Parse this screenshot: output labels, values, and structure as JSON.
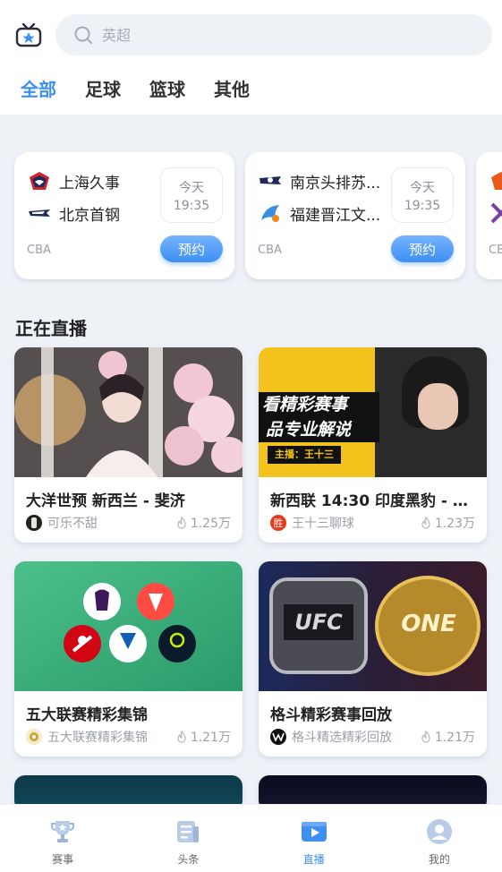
{
  "header": {
    "search_placeholder": "英超",
    "tabs": [
      {
        "label": "全部",
        "active": true
      },
      {
        "label": "足球",
        "active": false
      },
      {
        "label": "篮球",
        "active": false
      },
      {
        "label": "其他",
        "active": false
      }
    ]
  },
  "matches": [
    {
      "home": "上海久事",
      "away": "北京首钢",
      "day": "今天",
      "time": "19:35",
      "league": "CBA",
      "button": "预约"
    },
    {
      "home": "南京头排苏...",
      "away": "福建晋江文...",
      "day": "今天",
      "time": "19:35",
      "league": "CBA",
      "button": "预约"
    },
    {
      "league": "CB"
    }
  ],
  "live": {
    "section_title": "正在直播",
    "items": [
      {
        "title": "大洋世预 新西兰 - 斐济",
        "streamer": "可乐不甜",
        "viewers": "1.25万"
      },
      {
        "title": "新西联 14:30 印度黑豹 - 富...",
        "streamer": "王十三聊球",
        "viewers": "1.23万",
        "avatar_text": "胜",
        "thumb_text_1": "看精彩赛事",
        "thumb_text_2": "品专业解说",
        "thumb_tag": "主播：王十三"
      },
      {
        "title": "五大联赛精彩集锦",
        "streamer": "五大联赛精彩集锦",
        "viewers": "1.21万"
      },
      {
        "title": "格斗精彩赛事回放",
        "streamer": "格斗精选精彩回放",
        "viewers": "1.21万",
        "thumb_text_1": "UFC",
        "thumb_text_2": "ONE"
      }
    ]
  },
  "nav": [
    {
      "label": "赛事",
      "icon": "trophy-icon"
    },
    {
      "label": "头条",
      "icon": "news-icon"
    },
    {
      "label": "直播",
      "icon": "play-icon",
      "active": true
    },
    {
      "label": "我的",
      "icon": "user-icon"
    }
  ],
  "colors": {
    "accent": "#3d8ff0",
    "background": "#eef1f6"
  }
}
